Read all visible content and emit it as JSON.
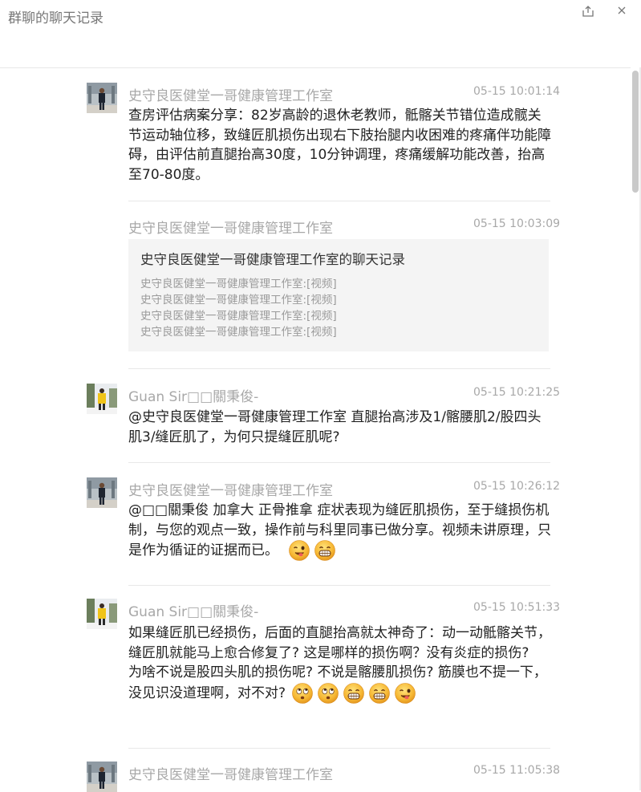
{
  "window": {
    "title": "群聊的聊天记录",
    "share_icon": "share-out-icon",
    "close_icon": "close-icon"
  },
  "messages": [
    {
      "sender": "史守良医健堂一哥健康管理工作室",
      "time": "05-15 10:01:14",
      "text": "查房评估病案分享：82岁高龄的退休老教师，骶髂关节错位造成髋关节运动轴位移，致缝匠肌损伤出现右下肢抬腿内收困难的疼痛伴功能障碍，由评估前直腿抬高30度，10分钟调理，疼痛缓解功能改善，抬高至70-80度。"
    },
    {
      "sender": "史守良医健堂一哥健康管理工作室",
      "time": "05-15 10:03:09",
      "card": {
        "title": "史守良医健堂一哥健康管理工作室的聊天记录",
        "lines": [
          "史守良医健堂一哥健康管理工作室:[视频]",
          "史守良医健堂一哥健康管理工作室:[视频]",
          "史守良医健堂一哥健康管理工作室:[视频]",
          "史守良医健堂一哥健康管理工作室:[视频]"
        ]
      }
    },
    {
      "sender": "Guan Sir□□關秉俊-",
      "time": "05-15 10:21:25",
      "text": "@史守良医健堂一哥健康管理工作室 直腿抬高涉及1/髂腰肌2/股四头肌3/缝匠肌了，为何只提缝匠肌呢?"
    },
    {
      "sender": "史守良医健堂一哥健康管理工作室",
      "time": "05-15 10:26:12",
      "text": "@□□關秉俊 加拿大 正骨推拿 症状表现为缝匠肌损伤，至于缝损伤机制，与您的观点一致，操作前与科里同事已做分享。视频未讲原理，只是作为循证的证据而已。",
      "emojis": [
        "wink-tongue-emoji",
        "grin-emoji"
      ]
    },
    {
      "sender": "Guan Sir□□關秉俊-",
      "time": "05-15 10:51:33",
      "text1": "如果缝匠肌已经损伤，后面的直腿抬高就太神奇了：动一动骶髂关节，缝匠肌就能马上愈合修复了? 这是哪样的损伤啊？没有炎症的损伤?",
      "text2": "为啥不说是股四头肌的损伤呢? 不说是髂腰肌损伤? 筋膜也不提一下，没见识没道理啊，对不对?",
      "emojis": [
        "eye-roll-emoji",
        "eye-roll-emoji",
        "grin-emoji",
        "grin-emoji",
        "wink-tongue-emoji"
      ]
    },
    {
      "sender": "史守良医健堂一哥健康管理工作室",
      "time": "05-15 11:05:38"
    }
  ]
}
